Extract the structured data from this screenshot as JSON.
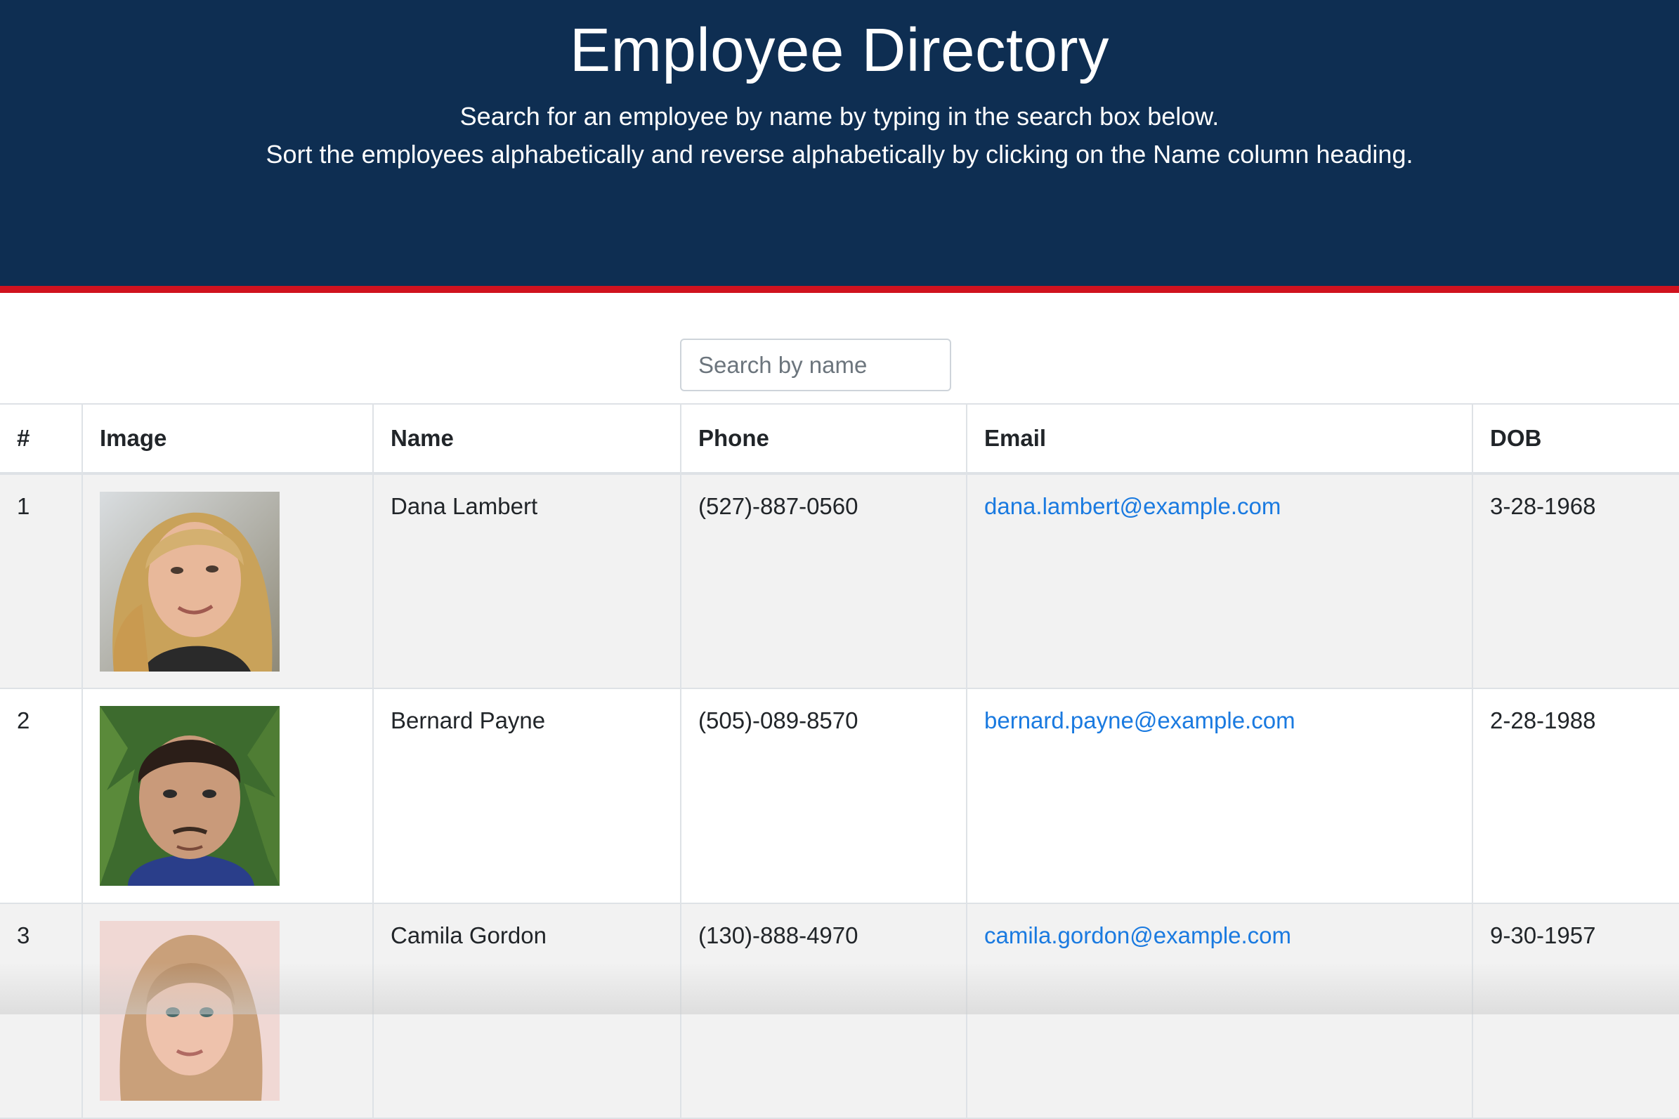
{
  "header": {
    "title": "Employee Directory",
    "subtitle_line1": "Search for an employee by name by typing in the search box below.",
    "subtitle_line2": "Sort the employees alphabetically and reverse alphabetically by clicking on the Name column heading.",
    "background_color": "#0e2e52",
    "accent_color": "#d0121e"
  },
  "search": {
    "placeholder": "Search by name",
    "value": ""
  },
  "table": {
    "columns": [
      "#",
      "Image",
      "Name",
      "Phone",
      "Email",
      "DOB"
    ],
    "rows": [
      {
        "index": "1",
        "image": "portrait-woman-blonde",
        "name": "Dana Lambert",
        "phone": "(527)-887-0560",
        "email": "dana.lambert@example.com",
        "dob": "3-28-1968"
      },
      {
        "index": "2",
        "image": "portrait-man-dark-hair",
        "name": "Bernard Payne",
        "phone": "(505)-089-8570",
        "email": "bernard.payne@example.com",
        "dob": "2-28-1988"
      },
      {
        "index": "3",
        "image": "portrait-woman-light-hair",
        "name": "Camila Gordon",
        "phone": "(130)-888-4970",
        "email": "camila.gordon@example.com",
        "dob": "9-30-1957"
      }
    ],
    "link_color": "#1a7ae0",
    "stripe_color": "#f2f2f2"
  }
}
